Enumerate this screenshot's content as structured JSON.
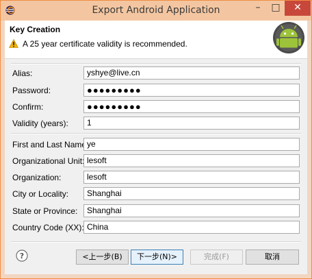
{
  "window": {
    "title": "Export Android Application",
    "close_glyph": "✕",
    "min_glyph": "–",
    "max_glyph": "□",
    "icon": "eclipse-icon"
  },
  "banner": {
    "title": "Key Creation",
    "message": "A 25 year certificate validity is recommended.",
    "warning_icon": "warning-icon",
    "logo_icon": "android-icon"
  },
  "form": {
    "alias": {
      "label": "Alias:",
      "value": "yshye@live.cn"
    },
    "password": {
      "label": "Password:",
      "value": "●●●●●●●●●"
    },
    "confirm": {
      "label": "Confirm:",
      "value": "●●●●●●●●●"
    },
    "validity": {
      "label": "Validity (years):",
      "value": "1"
    },
    "name": {
      "label": "First and Last Name:",
      "value": "ye"
    },
    "org_unit": {
      "label": "Organizational Unit:",
      "value": "lesoft"
    },
    "org": {
      "label": "Organization:",
      "value": "lesoft"
    },
    "city": {
      "label": "City or Locality:",
      "value": "Shanghai"
    },
    "state": {
      "label": "State or Province:",
      "value": "Shanghai"
    },
    "country": {
      "label": "Country Code (XX):",
      "value": "China"
    }
  },
  "buttons": {
    "back": "<上一步(B)",
    "next": "下一步(N)>",
    "finish": "完成(F)",
    "cancel": "取消",
    "help_icon": "help-icon"
  },
  "colors": {
    "accent": "#f08d41",
    "android_green": "#9dc33b",
    "warning": "#f0b400"
  }
}
